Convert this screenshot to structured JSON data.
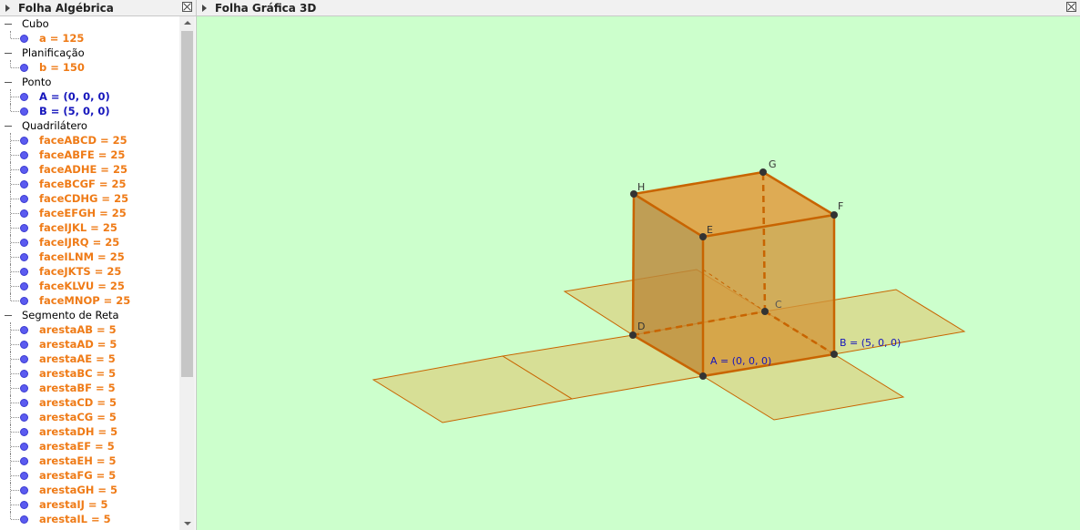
{
  "algebra_panel": {
    "title": "Folha Algébrica",
    "categories": [
      {
        "label": "Cubo",
        "items": [
          {
            "text": "a = 125",
            "color": "orange"
          }
        ]
      },
      {
        "label": "Planificação",
        "items": [
          {
            "text": "b = 150",
            "color": "orange"
          }
        ]
      },
      {
        "label": "Ponto",
        "items": [
          {
            "text": "A = (0, 0, 0)",
            "color": "blue"
          },
          {
            "text": "B = (5, 0, 0)",
            "color": "blue"
          }
        ]
      },
      {
        "label": "Quadrilátero",
        "items": [
          {
            "text": "faceABCD = 25",
            "color": "orange"
          },
          {
            "text": "faceABFE = 25",
            "color": "orange"
          },
          {
            "text": "faceADHE = 25",
            "color": "orange"
          },
          {
            "text": "faceBCGF = 25",
            "color": "orange"
          },
          {
            "text": "faceCDHG = 25",
            "color": "orange"
          },
          {
            "text": "faceEFGH = 25",
            "color": "orange"
          },
          {
            "text": "faceIJKL = 25",
            "color": "orange"
          },
          {
            "text": "faceIJRQ = 25",
            "color": "orange"
          },
          {
            "text": "faceILNM = 25",
            "color": "orange"
          },
          {
            "text": "faceJKTS = 25",
            "color": "orange"
          },
          {
            "text": "faceKLVU = 25",
            "color": "orange"
          },
          {
            "text": "faceMNOP = 25",
            "color": "orange"
          }
        ]
      },
      {
        "label": "Segmento de Reta",
        "items": [
          {
            "text": "arestaAB = 5",
            "color": "orange"
          },
          {
            "text": "arestaAD = 5",
            "color": "orange"
          },
          {
            "text": "arestaAE = 5",
            "color": "orange"
          },
          {
            "text": "arestaBC = 5",
            "color": "orange"
          },
          {
            "text": "arestaBF = 5",
            "color": "orange"
          },
          {
            "text": "arestaCD = 5",
            "color": "orange"
          },
          {
            "text": "arestaCG = 5",
            "color": "orange"
          },
          {
            "text": "arestaDH = 5",
            "color": "orange"
          },
          {
            "text": "arestaEF = 5",
            "color": "orange"
          },
          {
            "text": "arestaEH = 5",
            "color": "orange"
          },
          {
            "text": "arestaFG = 5",
            "color": "orange"
          },
          {
            "text": "arestaGH = 5",
            "color": "orange"
          },
          {
            "text": "arestaIJ = 5",
            "color": "orange"
          },
          {
            "text": "arestaIL = 5",
            "color": "orange"
          }
        ]
      }
    ]
  },
  "graphics_panel": {
    "title": "Folha Gráfica 3D",
    "background": "#ccffcc",
    "point_labels": {
      "A": "A = (0, 0, 0)",
      "B": "B = (5, 0, 0)",
      "C": "C",
      "D": "D",
      "E": "E",
      "F": "F",
      "G": "G",
      "H": "H"
    },
    "colors": {
      "net_fill": "#d8d98c",
      "cube_fill": "#d79a3a",
      "edge": "#c86400",
      "point": "#333333",
      "point_label": "#1616bc"
    }
  }
}
